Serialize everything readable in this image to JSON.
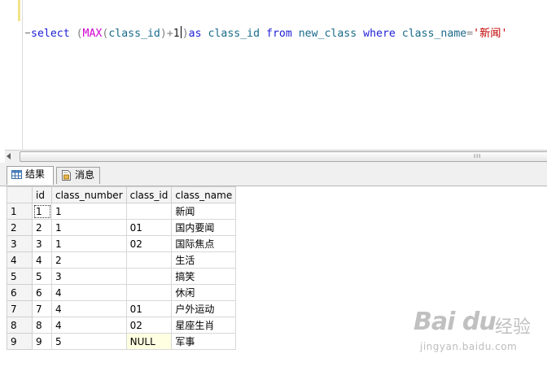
{
  "editor": {
    "tokens": {
      "select": "select",
      "open_paren": "(",
      "max": "MAX",
      "inner_open": "(",
      "arg": "class_id",
      "inner_close": ")",
      "plus": "+",
      "one": "1",
      "close_paren": ")",
      "as_kw": "as",
      "alias": "class_id",
      "from_kw": "from",
      "table": "new_class",
      "where_kw": "where",
      "col": "class_name",
      "eq": "=",
      "value": "'新闻'"
    }
  },
  "scrollbar": {
    "grip": "III"
  },
  "tabs": [
    {
      "label": "结果",
      "icon": "grid-icon"
    },
    {
      "label": "消息",
      "icon": "message-icon"
    }
  ],
  "grid": {
    "columns": [
      "id",
      "class_number",
      "class_id",
      "class_name"
    ],
    "rows": [
      {
        "rownum": "1",
        "id": "1",
        "class_number": "1",
        "class_id": "",
        "class_name": "新闻"
      },
      {
        "rownum": "2",
        "id": "2",
        "class_number": "1",
        "class_id": "01",
        "class_name": "国内要闻"
      },
      {
        "rownum": "3",
        "id": "3",
        "class_number": "1",
        "class_id": "02",
        "class_name": "国际焦点"
      },
      {
        "rownum": "4",
        "id": "4",
        "class_number": "2",
        "class_id": "",
        "class_name": "生活"
      },
      {
        "rownum": "5",
        "id": "5",
        "class_number": "3",
        "class_id": "",
        "class_name": "搞笑"
      },
      {
        "rownum": "6",
        "id": "6",
        "class_number": "4",
        "class_id": "",
        "class_name": "休闲"
      },
      {
        "rownum": "7",
        "id": "7",
        "class_number": "4",
        "class_id": "01",
        "class_name": "户外运动"
      },
      {
        "rownum": "8",
        "id": "8",
        "class_number": "4",
        "class_id": "02",
        "class_name": "星座生肖"
      },
      {
        "rownum": "9",
        "id": "9",
        "class_number": "5",
        "class_id": "NULL",
        "class_name": "军事"
      }
    ]
  },
  "watermark": {
    "logo": "Bai du",
    "text": "经验",
    "url": "jingyan.baidu.com"
  }
}
